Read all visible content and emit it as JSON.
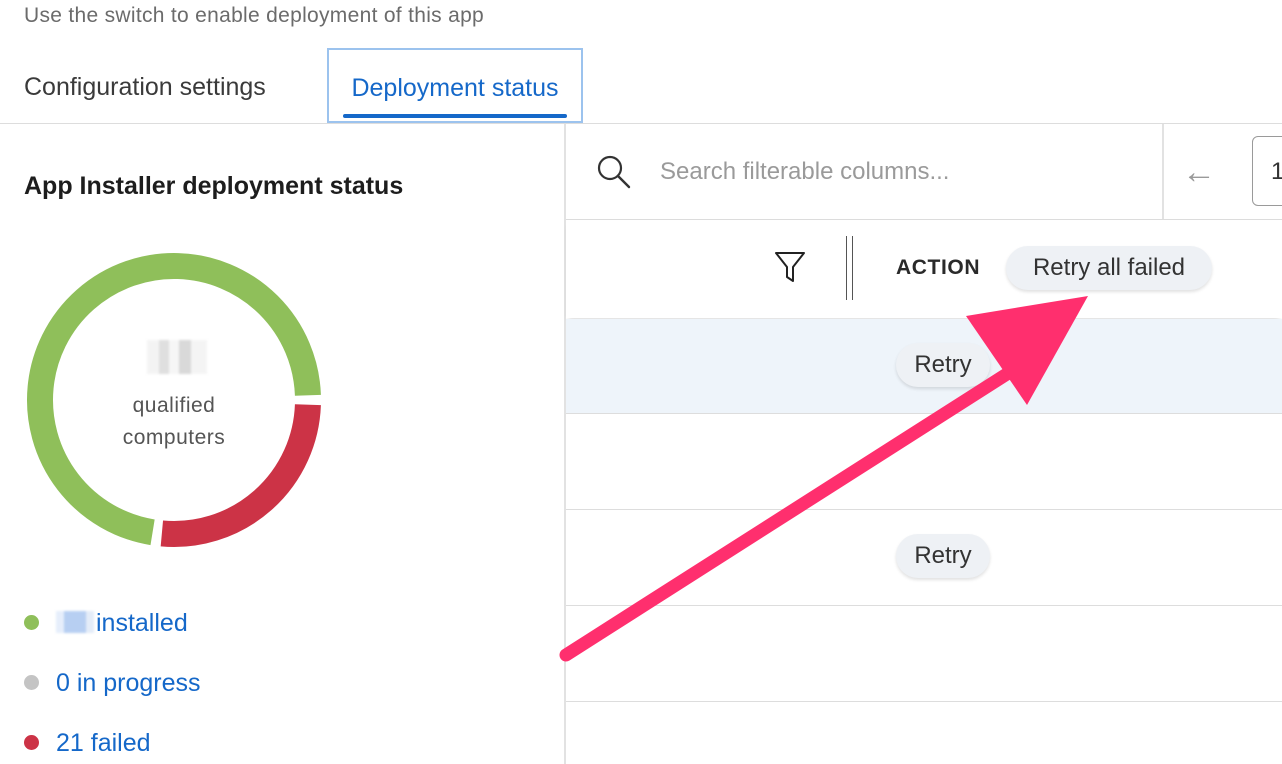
{
  "header": {
    "subtitle": "Use the switch to enable deployment of this app"
  },
  "tabs": [
    {
      "label": "Configuration settings",
      "active": false
    },
    {
      "label": "Deployment status",
      "active": true
    }
  ],
  "status_panel": {
    "title": "App Installer deployment status",
    "center_label_line1": "qualified",
    "center_label_line2": "computers",
    "donut_fractions": {
      "installed": 0.73,
      "in_progress": 0,
      "failed": 0.27
    },
    "legend": [
      {
        "label": "installed",
        "color": "#8fbf5a"
      },
      {
        "label": "0 in progress",
        "color": "#c4c4c4"
      },
      {
        "label": "21 failed",
        "color": "#cc3346"
      }
    ]
  },
  "table": {
    "search_placeholder": "Search filterable columns...",
    "prev_icon": "arrow-left-icon",
    "page_number": "1",
    "action_header": "ACTION",
    "retry_all_label": "Retry all failed",
    "rows": [
      {
        "action": "Retry",
        "highlighted": true
      },
      {
        "action": ""
      },
      {
        "action": "Retry"
      },
      {
        "action": ""
      },
      {
        "action": ""
      }
    ]
  },
  "annotation": {
    "arrow_color": "#ff2f6e"
  }
}
